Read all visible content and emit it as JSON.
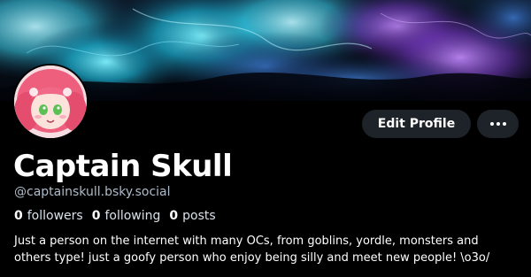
{
  "profile": {
    "banner_image": "cosmic-fractal-nebula-banner",
    "avatar_image": "pink-haired-anime-character-avatar",
    "display_name": "Captain Skull",
    "handle": "@captainskull.bsky.social",
    "stats": [
      {
        "count": "0",
        "label": "followers"
      },
      {
        "count": "0",
        "label": "following"
      },
      {
        "count": "0",
        "label": "posts"
      }
    ],
    "bio_lines": [
      "Just a person on the internet with many OCs, from goblins, yordle, monsters and",
      "others type! just a goofy person who enjoy being silly and meet new people! \\o3o/"
    ]
  },
  "actions": {
    "edit_profile_label": "Edit Profile",
    "more_icon": "ellipsis-icon"
  },
  "colors": {
    "background": "#000000",
    "button_bg": "#1e2329",
    "text_primary": "#ffffff",
    "text_secondary": "#aebbc9"
  }
}
